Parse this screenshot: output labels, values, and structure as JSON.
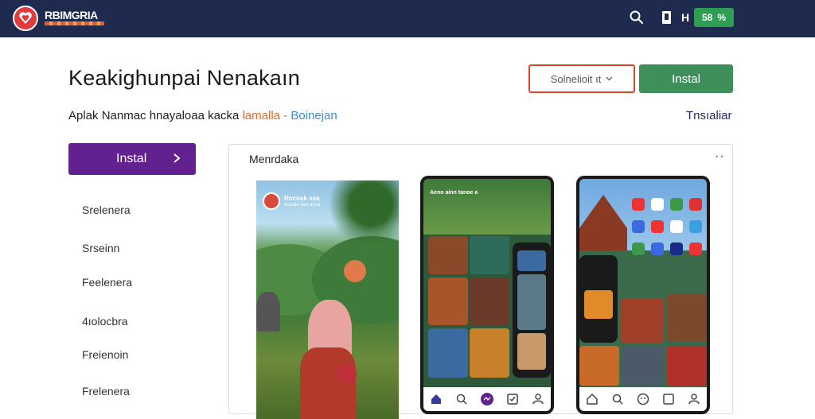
{
  "brand": {
    "name": "RBIMGRIA",
    "accent": "#e23b3b",
    "topbar_bg": "#1f2a4f"
  },
  "topbar": {
    "search_icon": "search-icon",
    "book_icon": "book-icon",
    "h_label": "H",
    "pill_left": "58",
    "pill_right": "%"
  },
  "header": {
    "title": "Keakighunpai Nenakaın",
    "select_value": "Solnelioit ıt",
    "install_label": "Instal",
    "subtitle_main": "Aplak Nanmac hnayaloaa kacka",
    "subtitle_hl1": "lamalla",
    "subtitle_sep": "-",
    "subtitle_hl2": "Boinejan",
    "right_link": "Tnsıaliar"
  },
  "sidebar": {
    "install_button": "Instal",
    "items": [
      {
        "label": "Srelenera"
      },
      {
        "label": "Srseinn"
      },
      {
        "label": "Feelenera"
      },
      {
        "label": "4ıolocbra"
      },
      {
        "label": "Freienoin"
      },
      {
        "label": "Frelenera"
      }
    ]
  },
  "card": {
    "title": "Menrdaka",
    "more": "··",
    "photo": {
      "title": "Rocnsk ssa",
      "subtitle": "Ncaala naa arsıa"
    },
    "phone1": {
      "header": "Aeno ainn tanoe a"
    },
    "nav_labels": [
      "Home",
      "Search",
      "Add",
      "Saved",
      "Profile"
    ]
  }
}
